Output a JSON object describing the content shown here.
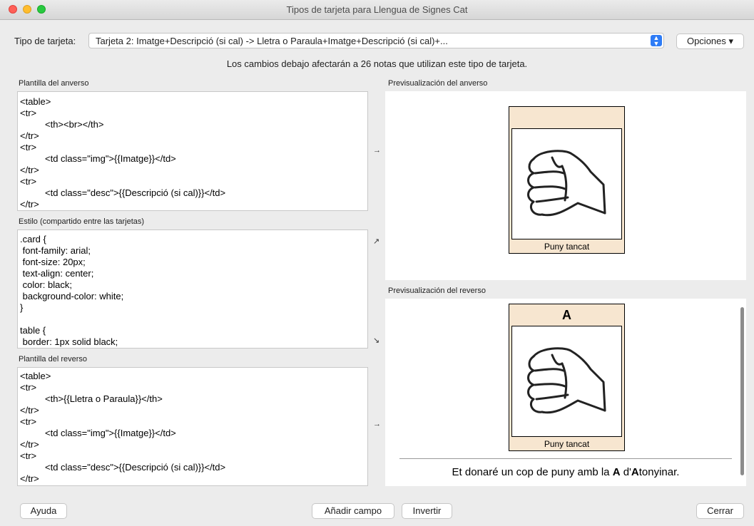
{
  "window": {
    "title": "Tipos de tarjeta para Llengua de Signes Cat"
  },
  "toolbar": {
    "type_label": "Tipo de tarjeta:",
    "type_value": "Tarjeta 2: Imatge+Descripció (si cal) -> Lletra o Paraula+Imatge+Descripció (si cal)+...",
    "options_label": "Opciones ▾"
  },
  "notice": "Los cambios debajo afectarán a 26 notas que utilizan este tipo de tarjeta.",
  "front_template": {
    "label": "Plantilla del anverso",
    "lines": [
      "<table>",
      "<tr>",
      "<th><br></th>",
      "</tr>",
      "<tr>",
      "<td class=\"img\">{{Imatge}}</td>",
      "</tr>",
      "<tr>",
      "<td class=\"desc\">{{Descripció (si cal)}}</td>",
      "</tr>"
    ]
  },
  "styling": {
    "label": "Estilo (compartido entre las tarjetas)",
    "lines": [
      ".card {",
      " font-family: arial;",
      " font-size: 20px;",
      " text-align: center;",
      " color: black;",
      " background-color: white;",
      "}",
      "",
      "table {",
      " border: 1px solid black;"
    ]
  },
  "back_template": {
    "label": "Plantilla del reverso",
    "lines": [
      "<table>",
      "<tr>",
      "<th>{{Lletra o Paraula}}</th>",
      "</tr>",
      "<tr>",
      "<td class=\"img\">{{Imatge}}</td>",
      "</tr>",
      "<tr>",
      "<td class=\"desc\">{{Descripció (si cal)}}</td>",
      "</tr>"
    ]
  },
  "arrows": {
    "front": "→",
    "style": "↗",
    "style_down": "↘",
    "back": "→"
  },
  "front_preview": {
    "label": "Previsualización del anverso",
    "caption": "Puny tancat"
  },
  "back_preview": {
    "label": "Previsualización del reverso",
    "letter": "A",
    "caption": "Puny tancat",
    "answer_pre": "Et donaré un cop de puny amb la ",
    "answer_bold1": "A",
    "answer_mid": " d'",
    "answer_bold2": "A",
    "answer_post": "tonyinar."
  },
  "buttons": {
    "help": "Ayuda",
    "add_field": "Añadir campo",
    "flip": "Invertir",
    "close": "Cerrar"
  }
}
